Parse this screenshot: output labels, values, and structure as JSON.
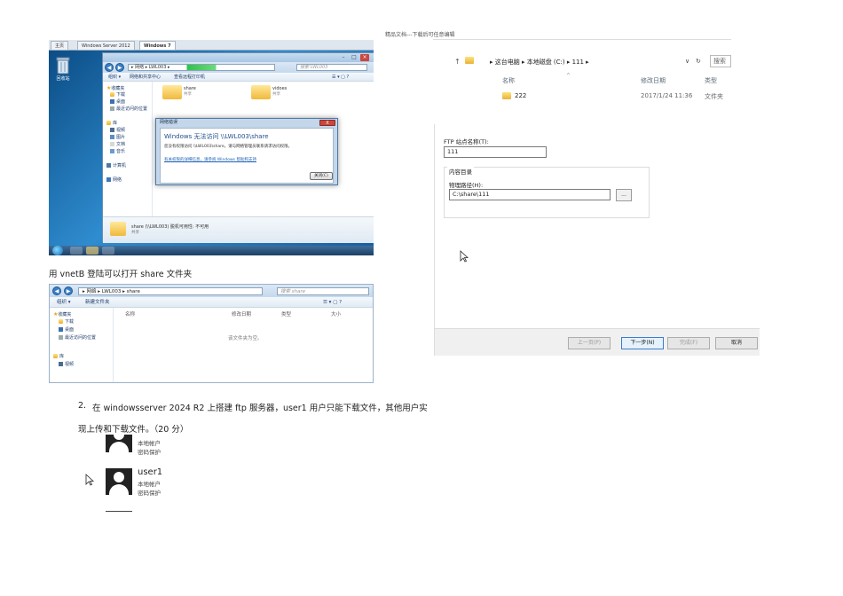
{
  "doc": {
    "header_note": "精品文档---下载后可任意编辑",
    "caption1": "用 vnetB 登陆可以打开 share 文件夹",
    "question": {
      "number": "2.",
      "line1": "在 windowsserver 2024 R2 上搭建 ftp 服务器，user1 用户只能下载文件，其他用户实",
      "line2": "现上传和下载文件。（20 分）"
    }
  },
  "shot1": {
    "browser_tabs": [
      "主页",
      "Windows Server 2012",
      "Windows 7"
    ],
    "recycle_label": "回收站",
    "address": "▸ 网络 ▸ LWL003 ▸",
    "search_placeholder": "搜索 LWL003",
    "toolbar": [
      "组织 ▾",
      "网络和共享中心",
      "查看远程打印机"
    ],
    "sidebar": [
      "收藏夹",
      "下载",
      "桌面",
      "最近访问的位置",
      "库",
      "视频",
      "图片",
      "文档",
      "音乐",
      "计算机",
      "网络"
    ],
    "folders": [
      {
        "name": "share",
        "sub": "共享"
      },
      {
        "name": "vidoes",
        "sub": "共享"
      }
    ],
    "dialog": {
      "title": "网络错误",
      "close": "X",
      "heading": "Windows 无法访问 \\\\LWL003\\share",
      "text": "您没有权限访问 \\\\LWL003\\share。请与网络管理员联系请求访问权限。",
      "link": "有关权限的详细信息，请参阅 Windows 帮助和支持",
      "button": "关闭(C)"
    },
    "status": {
      "name": "share (\\\\LWL003)  脱机可用性: 不可用",
      "sub": "共享"
    }
  },
  "shot2": {
    "address": "▸ 网络 ▸ LWL003 ▸ share",
    "search_placeholder": "搜索 share",
    "toolbar": [
      "组织 ▾",
      "新建文件夹"
    ],
    "sidebar": [
      "收藏夹",
      "下载",
      "桌面",
      "最近访问的位置",
      "库",
      "视频"
    ],
    "columns": [
      "名称",
      "修改日期",
      "类型",
      "大小"
    ],
    "empty": "该文件夹为空。"
  },
  "user_tiles": [
    {
      "name": "",
      "type": "本地帐户",
      "pw": "密码保护"
    },
    {
      "name": "user1",
      "type": "本地帐户",
      "pw": "密码保护"
    }
  ],
  "shot3": {
    "path": "▸ 这台电脑 ▸ 本地磁盘 (C:) ▸ 111 ▸",
    "search": "搜索",
    "columns": [
      "名称",
      "修改日期",
      "类型"
    ],
    "rows": [
      {
        "name": "222",
        "date": "2017/1/24 11:36",
        "type": "文件夹"
      }
    ]
  },
  "shot4": {
    "site_name_label": "FTP 站点名称(T):",
    "site_name_value": "111",
    "group_label": "内容目录",
    "path_label": "物理路径(H):",
    "path_value": "C:\\share\\111",
    "browse": "...",
    "buttons": {
      "prev": "上一页(P)",
      "next": "下一步(N)",
      "finish": "完成(F)",
      "cancel": "取消"
    }
  }
}
